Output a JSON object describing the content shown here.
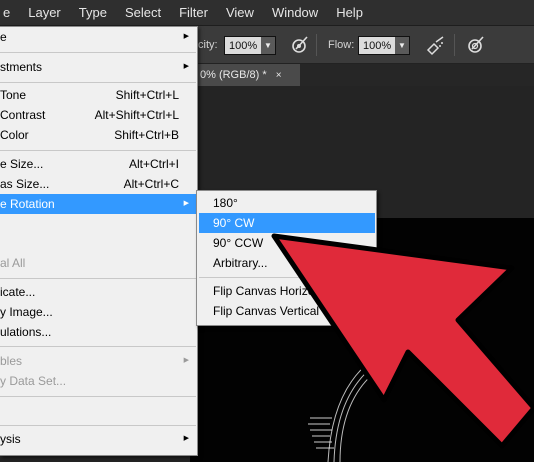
{
  "menubar": {
    "items": [
      {
        "label": "e",
        "name": "menu-image-partial"
      },
      {
        "label": "Layer",
        "name": "menu-layer"
      },
      {
        "label": "Type",
        "name": "menu-type"
      },
      {
        "label": "Select",
        "name": "menu-select"
      },
      {
        "label": "Filter",
        "name": "menu-filter"
      },
      {
        "label": "View",
        "name": "menu-view"
      },
      {
        "label": "Window",
        "name": "menu-window"
      },
      {
        "label": "Help",
        "name": "menu-help"
      }
    ]
  },
  "options": {
    "opacity_label": "city:",
    "opacity_value": "100%",
    "flow_label": "Flow:",
    "flow_value": "100%",
    "icons": [
      "pressure-opacity-icon",
      "airbrush-icon",
      "pressure-size-icon"
    ]
  },
  "document_tab": {
    "title": "0% (RGB/8) *",
    "close": "×"
  },
  "image_menu": {
    "items": [
      {
        "label": "e",
        "shortcut": "",
        "submenu": true,
        "disabled": false
      },
      {
        "label": "stments",
        "shortcut": "",
        "submenu": true,
        "disabled": false
      },
      {
        "label": "Tone",
        "shortcut": "Shift+Ctrl+L",
        "submenu": false,
        "disabled": false
      },
      {
        "label": "Contrast",
        "shortcut": "Alt+Shift+Ctrl+L",
        "submenu": false,
        "disabled": false
      },
      {
        "label": "Color",
        "shortcut": "Shift+Ctrl+B",
        "submenu": false,
        "disabled": false
      },
      {
        "label": "e Size...",
        "shortcut": "Alt+Ctrl+I",
        "submenu": false,
        "disabled": false
      },
      {
        "label": "as Size...",
        "shortcut": "Alt+Ctrl+C",
        "submenu": false,
        "disabled": false
      },
      {
        "label": "e Rotation",
        "shortcut": "",
        "submenu": true,
        "disabled": false,
        "highlight": true
      },
      {
        "label": "",
        "shortcut": "",
        "submenu": false,
        "disabled": false
      },
      {
        "label": "al All",
        "shortcut": "",
        "submenu": false,
        "disabled": true
      },
      {
        "label": "icate...",
        "shortcut": "",
        "submenu": false,
        "disabled": false
      },
      {
        "label": "y Image...",
        "shortcut": "",
        "submenu": false,
        "disabled": false
      },
      {
        "label": "ulations...",
        "shortcut": "",
        "submenu": false,
        "disabled": false
      },
      {
        "label": "bles",
        "shortcut": "",
        "submenu": true,
        "disabled": true
      },
      {
        "label": "y Data Set...",
        "shortcut": "",
        "submenu": false,
        "disabled": true
      },
      {
        "label": "",
        "shortcut": "",
        "submenu": false,
        "disabled": false
      },
      {
        "label": "ysis",
        "shortcut": "",
        "submenu": true,
        "disabled": false
      }
    ],
    "submenu_glyph": "▶"
  },
  "rotation_menu": {
    "items": [
      {
        "label": "180°",
        "highlight": false
      },
      {
        "label": "90° CW",
        "highlight": true
      },
      {
        "label": "90° CCW",
        "highlight": false
      },
      {
        "label": "Arbitrary...",
        "highlight": false
      },
      {
        "label": "Flip Canvas Horizontal",
        "highlight": false
      },
      {
        "label": "Flip Canvas Vertical",
        "highlight": false
      }
    ]
  },
  "colors": {
    "menu_highlight": "#3399ff",
    "arrow_fill": "#e02a3a",
    "arrow_stroke": "#000000"
  }
}
